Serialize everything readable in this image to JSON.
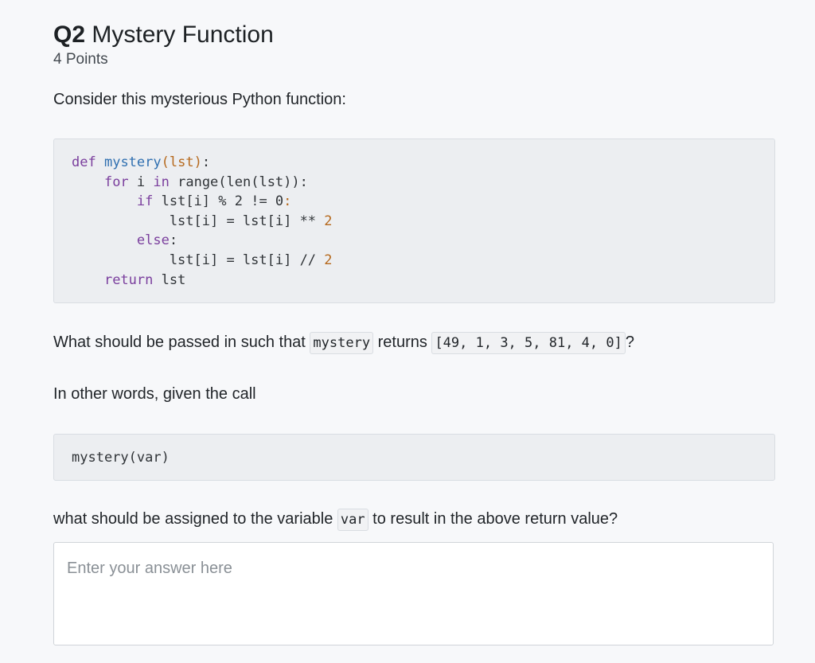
{
  "question": {
    "number": "Q2",
    "title": "Mystery Function",
    "points": "4 Points"
  },
  "prompt": {
    "intro": "Consider this mysterious Python function:",
    "ask_prefix": "What should be passed in such that ",
    "ask_code_function": "mystery",
    "ask_middle": " returns ",
    "ask_code_result": "[49, 1, 3, 5, 81, 4, 0]",
    "ask_suffix": "?",
    "other_words": "In other words, given the call",
    "final_prefix": "what should be assigned to the variable ",
    "final_code_var": "var",
    "final_suffix": " to result in the above return value?"
  },
  "code": {
    "function_lines": [
      "def mystery(lst):",
      "    for i in range(len(lst)):",
      "        if lst[i] % 2 != 0:",
      "            lst[i] = lst[i] ** 2",
      "        else:",
      "            lst[i] = lst[i] // 2",
      "    return lst"
    ],
    "call": "mystery(var)"
  },
  "answer": {
    "placeholder": "Enter your answer here",
    "value": ""
  },
  "colors": {
    "keyword": "#7a3e9d",
    "function_name": "#2f6fb0",
    "number": "#b6691d",
    "code_background": "#eceef1",
    "page_background": "#f7f8fa"
  }
}
